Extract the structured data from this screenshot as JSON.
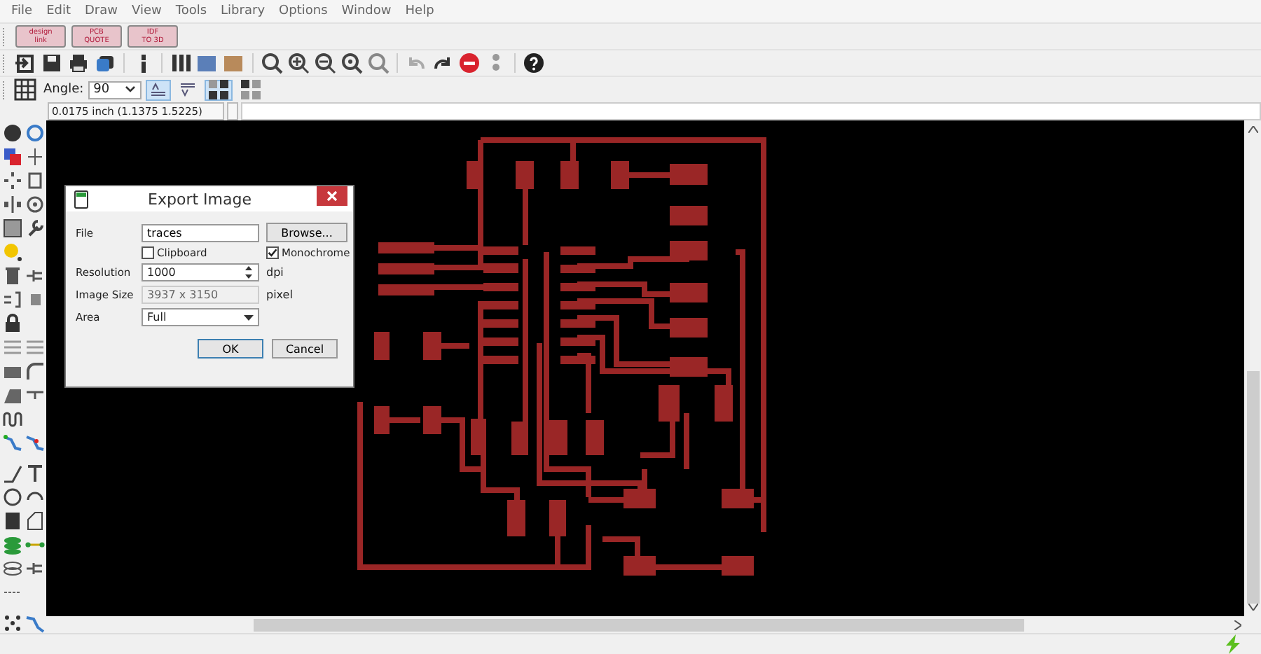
{
  "menu": [
    "File",
    "Edit",
    "Draw",
    "View",
    "Tools",
    "Library",
    "Options",
    "Window",
    "Help"
  ],
  "logo_buttons": [
    {
      "line1": "design",
      "line2": "link"
    },
    {
      "line1": "PCB",
      "line2": "QUOTE"
    },
    {
      "line1": "IDF",
      "line2": "TO 3D"
    }
  ],
  "angle": {
    "label": "Angle:",
    "value": "90"
  },
  "text_toggles": [
    {
      "selected": true
    },
    {
      "selected": false
    }
  ],
  "layout_toggles": [
    {
      "selected": true
    },
    {
      "selected": false
    }
  ],
  "coordinates": "0.0175 inch (1.1375 1.5225)",
  "dialog": {
    "title": "Export Image",
    "file": {
      "label": "File",
      "value": "traces"
    },
    "browse": "Browse...",
    "checkboxes": [
      {
        "label": "Clipboard",
        "checked": false
      },
      {
        "label": "Monochrome",
        "checked": true
      }
    ],
    "resolution": {
      "label": "Resolution",
      "value": "1000",
      "unit": "dpi"
    },
    "image_size": {
      "label": "Image Size",
      "value": "3937 x 3150",
      "unit": "pixel",
      "disabled": true
    },
    "area": {
      "label": "Area",
      "value": "Full"
    },
    "buttons": [
      "OK",
      "Cancel"
    ]
  }
}
